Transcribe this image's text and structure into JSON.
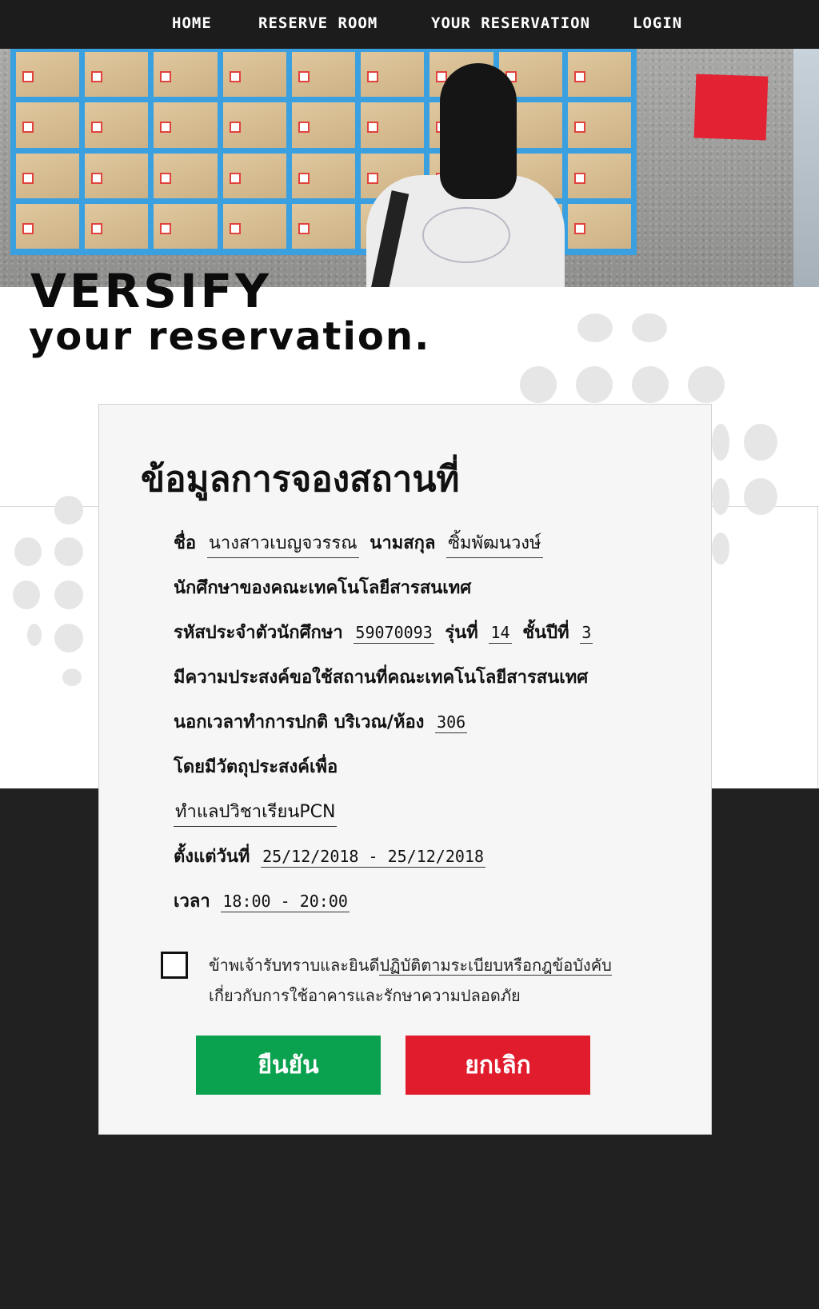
{
  "nav": {
    "items": [
      {
        "label": "HOME"
      },
      {
        "label": "RESERVE ROOM"
      },
      {
        "label": "YOUR RESERVATION"
      },
      {
        "label": "LOGIN"
      }
    ]
  },
  "hero": {
    "heading_line1": "VERSIFY",
    "heading_line2": "your reservation."
  },
  "card": {
    "title": "ข้อมูลการจองสถานที่",
    "name_label": "ชื่อ",
    "first_name": "นางสาวเบญจวรรณ",
    "surname_label": "นามสกุล",
    "surname": "ซิ้มพัฒนวงษ์",
    "faculty_line": "นักศึกษาของคณะเทคโนโลยีสารสนเทศ",
    "student_id_label": "รหัสประจำตัวนักศึกษา",
    "student_id": "59070093",
    "generation_label": "รุ่นที่",
    "generation": "14",
    "year_label": "ชั้นปีที่",
    "year": "3",
    "intent_line": "มีความประสงค์ขอใช้สถานที่คณะเทคโนโลยีสารสนเทศ",
    "room_label": "นอกเวลาทำการปกติ บริเวณ/ห้อง",
    "room": "306",
    "purpose_label": "โดยมีวัตถุประสงค์เพื่อ",
    "purpose": "ทำแลปวิชาเรียนPCN",
    "date_label": "ตั้งแต่วันที่",
    "date_range": "25/12/2018 - 25/12/2018",
    "time_label": "เวลา",
    "time_range": "18:00 - 20:00",
    "agree_prefix": "ข้าพเจ้ารับทราบและยินดี",
    "agree_link": "ปฏิบัติตามระเบียบหรือกฎข้อบังคับ",
    "agree_suffix": "เกี่ยวกับการใช้อาคารและรักษาความปลอดภัย",
    "agree_checked": false,
    "confirm_label": "ยืนยัน",
    "cancel_label": "ยกเลิก"
  },
  "colors": {
    "nav_bg": "#1c1c1c",
    "confirm": "#0ba24f",
    "cancel": "#e11c2c",
    "dark_band": "#212121"
  }
}
